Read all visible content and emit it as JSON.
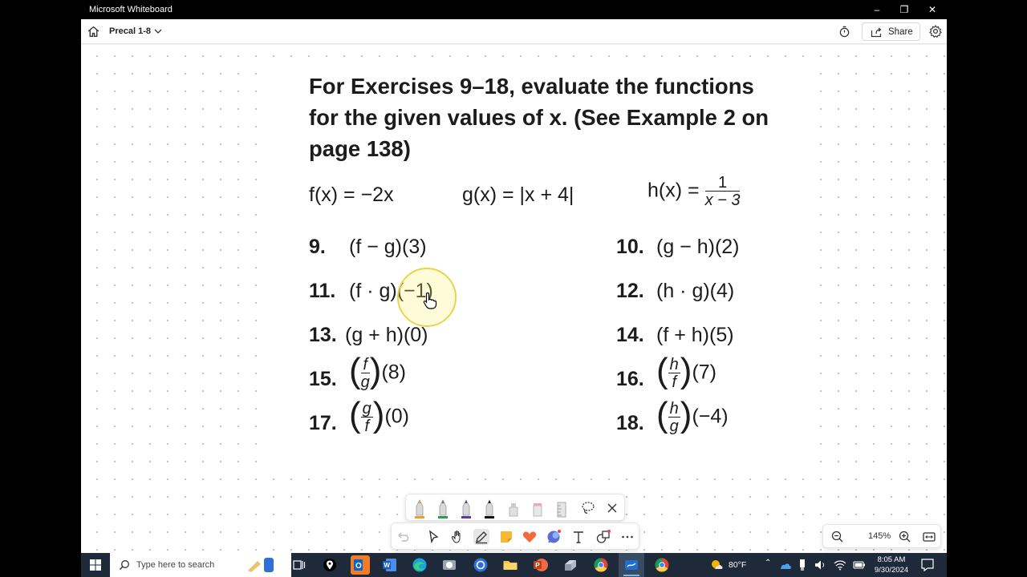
{
  "window": {
    "title": "Microsoft Whiteboard"
  },
  "header": {
    "board_name": "Precal 1-8",
    "share_label": "Share"
  },
  "content": {
    "heading_lines": [
      "For Exercises 9–18, evaluate the functions",
      "for the given values of x. (See Example 2 on",
      "page 138)"
    ],
    "functions": {
      "f": "f(x) = −2x",
      "g": "g(x) = |x + 4|",
      "h_prefix": "h(x) =",
      "h_num": "1",
      "h_den": "x − 3"
    },
    "exercises": [
      {
        "num": "9.",
        "expr": "(f − g)(3)"
      },
      {
        "num": "10.",
        "expr": "(g − h)(2)"
      },
      {
        "num": "11.",
        "expr": "(f · g)(−1)"
      },
      {
        "num": "12.",
        "expr": "(h · g)(4)"
      },
      {
        "num": "13.",
        "expr": "(g + h)(0)"
      },
      {
        "num": "14.",
        "expr": "(f + h)(5)"
      },
      {
        "num": "15.",
        "frac_num": "f",
        "frac_den": "g",
        "arg": "(8)"
      },
      {
        "num": "16.",
        "frac_num": "h",
        "frac_den": "f",
        "arg": "(7)"
      },
      {
        "num": "17.",
        "frac_num": "g",
        "frac_den": "f",
        "arg": "(0)"
      },
      {
        "num": "18.",
        "frac_num": "h",
        "frac_den": "g",
        "arg": "(−4)"
      }
    ]
  },
  "zoom": {
    "level": "145%"
  },
  "taskbar": {
    "search_placeholder": "Type here to search",
    "weather": "80°F",
    "time": "8:05 AM",
    "date": "9/30/2024"
  },
  "colors": {
    "canvas_dot": "#bdbdbd",
    "highlight_ring": "#e9d44a",
    "taskbar_bg": "#1e2a3a"
  }
}
